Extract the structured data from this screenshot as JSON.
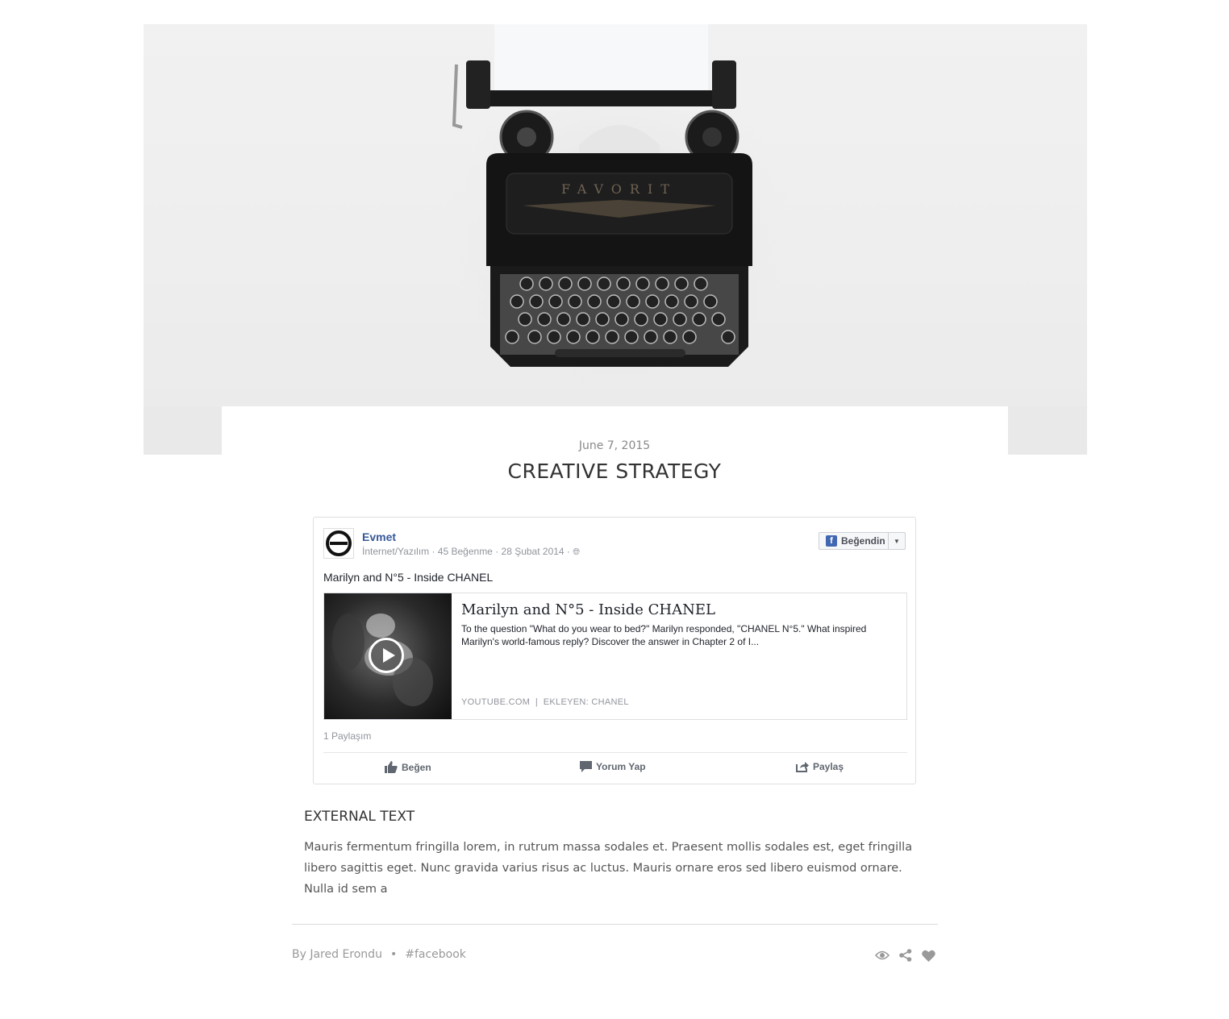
{
  "post": {
    "date": "June 7, 2015",
    "title": "CREATIVE STRATEGY"
  },
  "fb_embed": {
    "page_name": "Evmet",
    "meta": "İnternet/Yazılım · 45 Beğenme · 28 Şubat 2014 · ",
    "like_button": "Beğendin",
    "post_text": "Marilyn and N°5 - Inside CHANEL",
    "card": {
      "title": "Marilyn and N°5 - Inside CHANEL",
      "description": "To the question \"What do you wear to bed?\" Marilyn responded, \"CHANEL N°5.\" What inspired Marilyn's world-famous reply? Discover the answer in Chapter 2 of I...",
      "source": "YOUTUBE.COM  |  EKLEYEN: CHANEL"
    },
    "shares": "1 Paylaşım",
    "actions": {
      "like": "Beğen",
      "comment": "Yorum Yap",
      "share": "Paylaş"
    }
  },
  "external": {
    "heading": "EXTERNAL TEXT",
    "body": "Mauris fermentum fringilla lorem, in rutrum massa sodales et. Praesent mollis sodales est, eget fringilla libero sagittis eget. Nunc gravida varius risus ac luctus. Mauris ornare eros sed libero euismod ornare. Nulla id sem a"
  },
  "footer": {
    "author": "By Jared Erondu",
    "tag": "#facebook",
    "icons": [
      "eye-icon",
      "share-icon",
      "heart-icon"
    ]
  }
}
